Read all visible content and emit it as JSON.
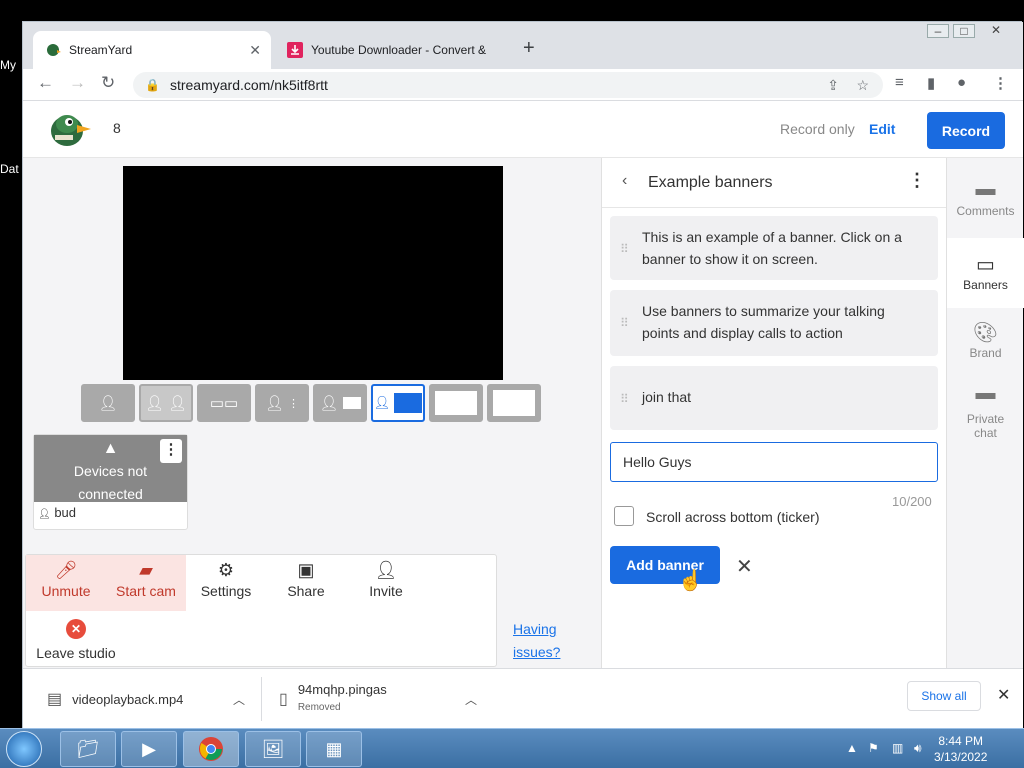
{
  "browser": {
    "tabs": [
      {
        "title": "StreamYard",
        "active": true
      },
      {
        "title": "Youtube Downloader - Convert &",
        "active": false
      }
    ],
    "url": "streamyard.com/nk5itf8rtt"
  },
  "desktop": {
    "icon_labels": [
      "My",
      "Dat"
    ]
  },
  "studio": {
    "viewer_count": "8",
    "record_only_label": "Record only",
    "edit_label": "Edit",
    "record_label": "Record"
  },
  "stage": {
    "guest": {
      "status": "Devices not connected",
      "name": "bud"
    },
    "controls": {
      "unmute": "Unmute",
      "start_cam": "Start cam",
      "settings": "Settings",
      "share": "Share",
      "invite": "Invite",
      "leave": "Leave studio"
    },
    "having_issues_line1": "Having",
    "having_issues_line2": "issues?"
  },
  "banners_panel": {
    "title": "Example banners",
    "banners": [
      "This is an example of a banner. Click on a banner to show it on screen.",
      "Use banners to summarize your talking points and display calls to action",
      "join that"
    ],
    "input_value": "Hello Guys",
    "char_counter": "10/200",
    "ticker_label": "Scroll across bottom (ticker)",
    "add_button": "Add banner"
  },
  "side_rail": {
    "comments": "Comments",
    "banners": "Banners",
    "brand": "Brand",
    "private_chat_1": "Private",
    "private_chat_2": "chat"
  },
  "downloads": {
    "item1": {
      "name": "videoplayback.mp4"
    },
    "item2": {
      "name": "94mqhp.pingas",
      "status": "Removed"
    },
    "show_all": "Show all"
  },
  "taskbar": {
    "time": "8:44 PM",
    "date": "3/13/2022"
  },
  "colors": {
    "accent": "#1a6be0",
    "mute_bg": "#fbe4e2"
  }
}
